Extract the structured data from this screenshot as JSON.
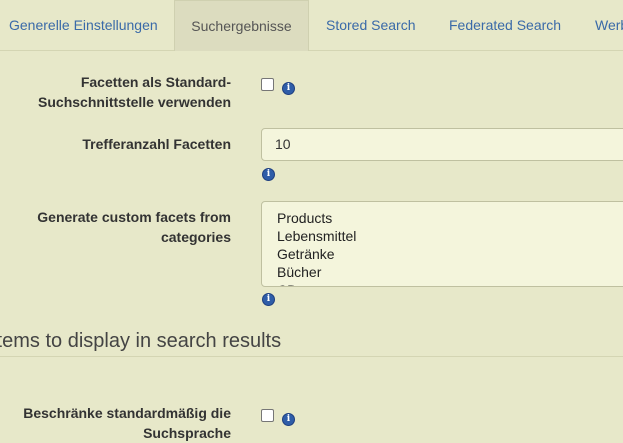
{
  "tabs": [
    {
      "label": "Generelle Einstellungen"
    },
    {
      "label": "Suchergebnisse"
    },
    {
      "label": "Stored Search"
    },
    {
      "label": "Federated Search"
    },
    {
      "label": "Werb"
    }
  ],
  "settings": {
    "facets_default": {
      "label_line1": "Facetten als Standard-",
      "label_line2": "Suchschnittstelle verwenden",
      "checked": false
    },
    "facet_hits": {
      "label": "Trefferanzahl Facetten",
      "value": "10"
    },
    "custom_facets": {
      "label_line1": "Generate custom facets from",
      "label_line2": "categories",
      "options": [
        "Products",
        "Lebensmittel",
        "Getränke",
        "Bücher",
        "CD"
      ]
    },
    "section_title": "Items to display in search results",
    "restrict_lang": {
      "label_line1": "Beschränke standardmäßig die",
      "label_line2": "Suchsprache",
      "checked": false
    }
  },
  "icons": {
    "info": "info-icon"
  },
  "colors": {
    "background": "#e7e8c9",
    "link": "#3a6aa8",
    "info": "#2f5da8"
  }
}
